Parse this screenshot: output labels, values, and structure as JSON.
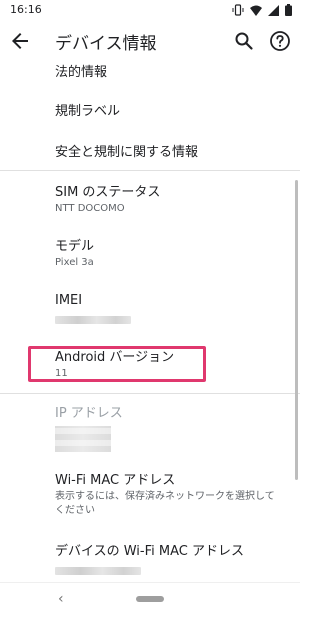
{
  "status": {
    "time": "16:16"
  },
  "app_bar": {
    "title": "デバイス情報"
  },
  "items": [
    {
      "title": "法的情報"
    },
    {
      "title": "規制ラベル"
    },
    {
      "title": "安全と規制に関する情報"
    },
    {
      "title": "SIM のステータス",
      "subtitle": "NTT DOCOMO"
    },
    {
      "title": "モデル",
      "subtitle": "Pixel 3a"
    },
    {
      "title": "IMEI"
    },
    {
      "title": "Android バージョン",
      "subtitle": "11"
    },
    {
      "title": "IP アドレス"
    },
    {
      "title": "Wi-Fi MAC アドレス",
      "subtitle": "表示するには、保存済みネットワークを選択してください"
    },
    {
      "title": "デバイスの Wi-Fi MAC アドレス"
    }
  ],
  "nav": {
    "back_glyph": "‹"
  },
  "colors": {
    "highlight": "#e0386e",
    "text": "#202124",
    "secondary": "#5f6368"
  }
}
